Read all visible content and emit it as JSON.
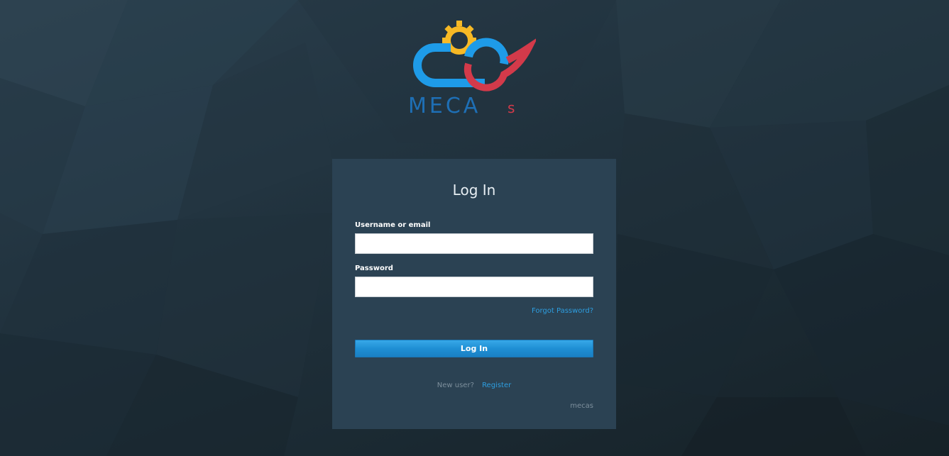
{
  "brand": {
    "logo_text": "MECAs",
    "colors": {
      "cloud_blue": "#1e9be8",
      "gear_yellow": "#f7b925",
      "accent_red": "#d33a4a"
    }
  },
  "login_form": {
    "title": "Log In",
    "username": {
      "label": "Username or email",
      "value": "",
      "placeholder": ""
    },
    "password": {
      "label": "Password",
      "value": "",
      "placeholder": ""
    },
    "forgot_password_label": "Forgot Password?",
    "submit_label": "Log In",
    "new_user_text": "New user?",
    "register_label": "Register",
    "footer_text": "mecas"
  },
  "colors": {
    "card_background": "#2b4253",
    "link": "#2d9ee0",
    "button": "#1f8fd4",
    "page_background": "#223440"
  }
}
